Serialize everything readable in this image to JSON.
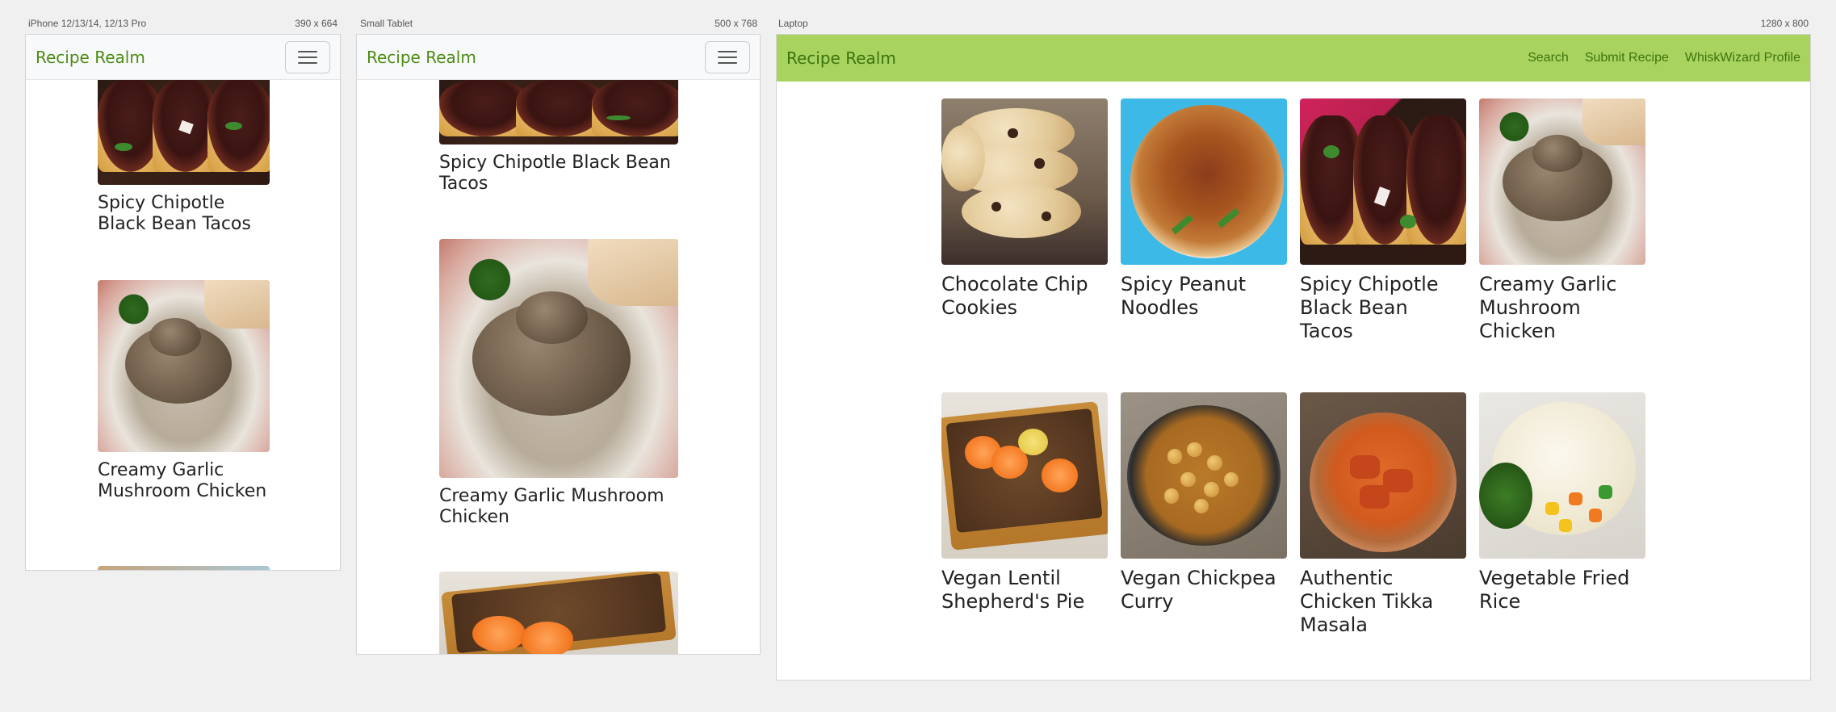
{
  "devices": {
    "phone": {
      "label": "iPhone 12/13/14, 12/13 Pro",
      "dims": "390 x 664"
    },
    "tablet": {
      "label": "Small Tablet",
      "dims": "500 x 768"
    },
    "laptop": {
      "label": "Laptop",
      "dims": "1280 x 800"
    }
  },
  "brand": "Recipe Realm",
  "nav": {
    "menu_icon": "hamburger-icon",
    "links": [
      "Search",
      "Submit Recipe",
      "WhiskWizard Profile"
    ]
  },
  "colors": {
    "brand_green": "#4c8c13",
    "laptop_navbar": "#a9d35f"
  },
  "phone_cards": [
    "Spicy Chipotle Black Bean Tacos",
    "Creamy Garlic Mushroom Chicken"
  ],
  "tablet_cards": [
    "Spicy Chipotle Black Bean Tacos",
    "Creamy Garlic Mushroom Chicken"
  ],
  "recipes": [
    "Chocolate Chip Cookies",
    "Spicy Peanut Noodles",
    "Spicy Chipotle Black Bean Tacos",
    "Creamy Garlic Mushroom Chicken",
    "Vegan Lentil Shepherd's Pie",
    "Vegan Chickpea Curry",
    "Authentic Chicken Tikka Masala",
    "Vegetable Fried Rice"
  ]
}
